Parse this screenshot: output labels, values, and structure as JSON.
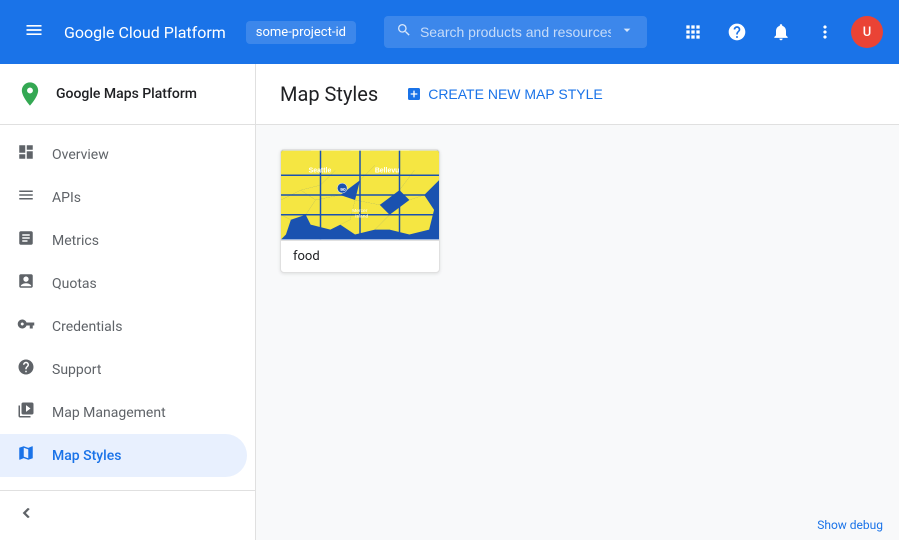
{
  "topnav": {
    "brand": "Google Cloud Platform",
    "project": "some-project-id",
    "search_placeholder": "Search products and resources",
    "hamburger_icon": "☰",
    "search_icon": "🔍",
    "dropdown_icon": "▾",
    "notifications_icon": "🔔",
    "help_icon": "?",
    "apps_icon": "⊞",
    "more_icon": "⋮",
    "avatar_initials": "U"
  },
  "sidebar": {
    "app_name": "Google Maps Platform",
    "nav_items": [
      {
        "id": "overview",
        "label": "Overview",
        "icon": "⊙"
      },
      {
        "id": "apis",
        "label": "APIs",
        "icon": "☰"
      },
      {
        "id": "metrics",
        "label": "Metrics",
        "icon": "📊"
      },
      {
        "id": "quotas",
        "label": "Quotas",
        "icon": "⊡"
      },
      {
        "id": "credentials",
        "label": "Credentials",
        "icon": "🔑"
      },
      {
        "id": "support",
        "label": "Support",
        "icon": "👤"
      },
      {
        "id": "map-management",
        "label": "Map Management",
        "icon": "⊞"
      },
      {
        "id": "map-styles",
        "label": "Map Styles",
        "icon": "◎",
        "active": true
      }
    ],
    "collapse_icon": "«"
  },
  "main": {
    "page_title": "Map Styles",
    "create_btn_label": "CREATE NEW MAP STYLE",
    "create_btn_icon": "＋",
    "map_style_card": {
      "name": "food"
    }
  },
  "bottom": {
    "debug_label": "Show debug"
  },
  "colors": {
    "accent": "#1a73e8",
    "active_bg": "#e8f0fe",
    "nav_bg": "#1a73e8"
  }
}
